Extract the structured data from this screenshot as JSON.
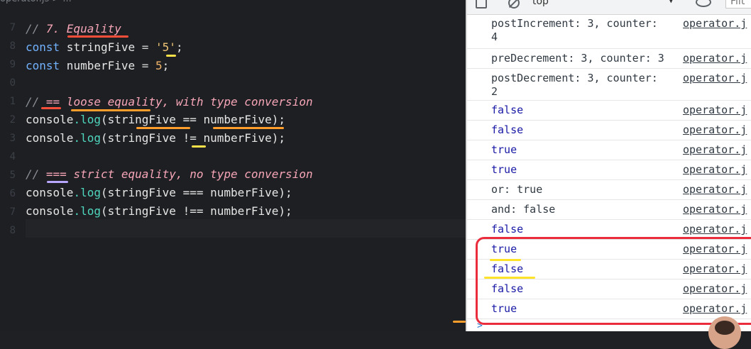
{
  "editor": {
    "breadcrumb": "operator.js > ...",
    "line_numbers": [
      "7",
      "8",
      "9",
      "0",
      "1",
      "2",
      "3",
      "4",
      "5",
      "6",
      "7",
      "8"
    ],
    "lines": [
      {
        "comment_prefix": "// ",
        "comment": "7. Equality"
      },
      {
        "kw": "const",
        "name": " stringFive ",
        "op": "= ",
        "str": "'5'",
        "end": ";"
      },
      {
        "kw": "const",
        "name": " numberFive ",
        "op": "= ",
        "num": "5",
        "end": ";"
      },
      {},
      {
        "comment_prefix": "// ",
        "comment": "== loose equality, with type conversion"
      },
      {
        "obj": "console",
        "fn": ".log",
        "args": "(stringFive == numberFive);"
      },
      {
        "obj": "console",
        "fn": ".log",
        "args": "(stringFive != numberFive);"
      },
      {},
      {
        "comment_prefix": "// ",
        "comment": "=== strict equality, no type conversion"
      },
      {
        "obj": "console",
        "fn": ".log",
        "args": "(stringFive === numberFive);"
      },
      {
        "obj": "console",
        "fn": ".log",
        "args": "(stringFive !== numberFive);"
      },
      {}
    ]
  },
  "devtools": {
    "context": "top",
    "filter_placeholder": "Filt",
    "rows": [
      {
        "message": "postIncrement: 3, counter:\n4",
        "source": "operator.j",
        "bool": false
      },
      {
        "message": "preDecrement: 3, counter: 3",
        "source": "operator.j",
        "bool": false
      },
      {
        "message": "postDecrement: 3, counter:\n2",
        "source": "operator.j",
        "bool": false
      },
      {
        "message": "false",
        "source": "operator.j",
        "bool": true
      },
      {
        "message": "false",
        "source": "operator.j",
        "bool": true
      },
      {
        "message": "true",
        "source": "operator.j",
        "bool": true
      },
      {
        "message": "true",
        "source": "operator.j",
        "bool": true
      },
      {
        "message": "or: true",
        "source": "operator.j",
        "bool": false
      },
      {
        "message": "and: false",
        "source": "operator.j",
        "bool": false
      },
      {
        "message": "false",
        "source": "operator.j",
        "bool": true
      },
      {
        "message": "true",
        "source": "operator.j",
        "bool": true
      },
      {
        "message": "false",
        "source": "operator.j",
        "bool": true
      },
      {
        "message": "false",
        "source": "operator.j",
        "bool": true
      },
      {
        "message": "true",
        "source": "operator.j",
        "bool": true
      }
    ],
    "prompt": ">"
  },
  "colors": {
    "annotation_orange": "#ff9e2c",
    "annotation_yellow": "#ffe14a",
    "highlight_red": "#ea2c3c"
  }
}
